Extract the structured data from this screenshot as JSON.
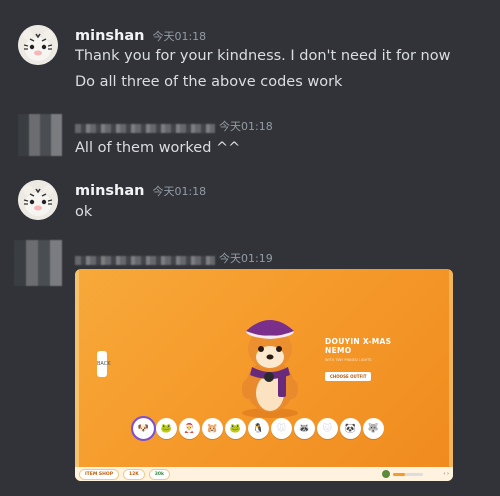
{
  "messages": [
    {
      "username": "minshan",
      "timestamp": "今天01:18",
      "lines": [
        "Thank you for your kindness. I don't need it for now",
        "Do all three of the above codes work"
      ]
    },
    {
      "username": "",
      "timestamp": "今天01:18",
      "lines": [
        "All of them worked ^^"
      ]
    },
    {
      "username": "minshan",
      "timestamp": "今天01:18",
      "lines": [
        "ok"
      ]
    },
    {
      "username": "",
      "timestamp": "今天01:19",
      "lines": []
    }
  ],
  "embed": {
    "promo_title": "DOUYIN X-MAS NEMO",
    "promo_subtitle": "WITH TINY PINNED LIGHTS",
    "promo_button": "CHOOSE OUTFIT",
    "back_label": "BACK",
    "bottom_pills": [
      "ITEM SHOP",
      "12K",
      "30k"
    ],
    "progress": 0.4,
    "characters": [
      "🐶",
      "🐸",
      "🎅",
      "🐹",
      "🐸",
      "🐧",
      "🐭",
      "🦝",
      "🐱",
      "🐼",
      "🐺"
    ]
  },
  "colors": {
    "background": "#313338",
    "username": "#f2f3f5",
    "timestamp": "#949ba4",
    "embed_orange": "#f59a2b"
  }
}
